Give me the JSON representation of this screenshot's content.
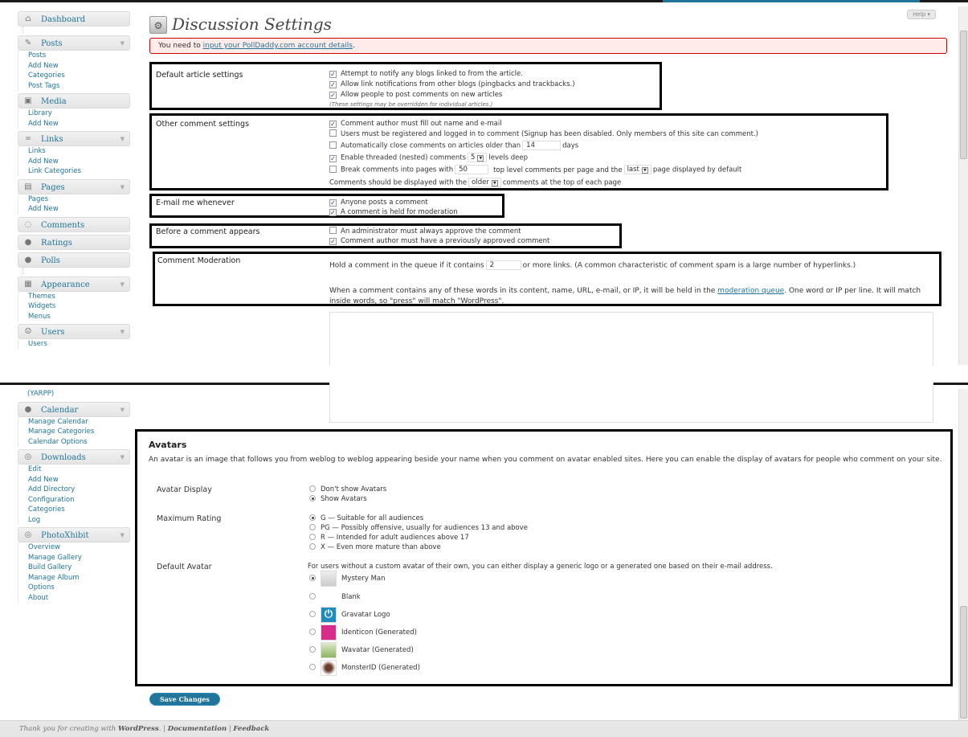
{
  "page": {
    "title": "Discussion Settings",
    "help": "Help ▾"
  },
  "notice": {
    "prefix": "You need to ",
    "link": "input your PollDaddy.com account details",
    "suffix": "."
  },
  "sidebar_top": {
    "dashboard": "Dashboard",
    "posts": "Posts",
    "posts_items": [
      "Posts",
      "Add New",
      "Categories",
      "Post Tags"
    ],
    "media": "Media",
    "media_items": [
      "Library",
      "Add New"
    ],
    "links": "Links",
    "links_items": [
      "Links",
      "Add New",
      "Link Categories"
    ],
    "pages": "Pages",
    "pages_items": [
      "Pages",
      "Add New"
    ],
    "comments": "Comments",
    "ratings": "Ratings",
    "polls": "Polls",
    "appearance": "Appearance",
    "appearance_items": [
      "Themes",
      "Widgets",
      "Menus"
    ],
    "users": "Users",
    "users_items": [
      "Users"
    ]
  },
  "sidebar_bottom": {
    "partial": "(YARPP)",
    "calendar": "Calendar",
    "calendar_items": [
      "Manage Calendar",
      "Manage Categories",
      "Calendar Options"
    ],
    "downloads": "Downloads",
    "downloads_items": [
      "Edit",
      "Add New",
      "Add Directory",
      "Configuration",
      "Categories",
      "Log"
    ],
    "photoxhibit": "PhotoXhibit",
    "photoxhibit_items": [
      "Overview",
      "Manage Gallery",
      "Build Gallery",
      "Manage Album",
      "Options",
      "About"
    ]
  },
  "default_article": {
    "label": "Default article settings",
    "opt1": "Attempt to notify any blogs linked to from the article.",
    "opt2": "Allow link notifications from other blogs (pingbacks and trackbacks.)",
    "opt3": "Allow people to post comments on new articles",
    "note": "(These settings may be overridden for individual articles.)"
  },
  "other_comment": {
    "label": "Other comment settings",
    "opt1": "Comment author must fill out name and e-mail",
    "opt2": "Users must be registered and logged in to comment (Signup has been disabled. Only members of this site can comment.)",
    "opt3_pre": "Automatically close comments on articles older than",
    "opt3_val": "14",
    "opt3_post": "days",
    "opt4_pre": "Enable threaded (nested) comments",
    "opt4_val": "5",
    "opt4_post": "levels deep",
    "opt5_pre": "Break comments into pages with",
    "opt5_val": "50",
    "opt5_mid": "top level comments per page and the",
    "opt5_sel": "last",
    "opt5_post": "page displayed by default",
    "opt6_pre": "Comments should be displayed with the",
    "opt6_sel": "older",
    "opt6_post": "comments at the top of each page"
  },
  "email_me": {
    "label": "E-mail me whenever",
    "opt1": "Anyone posts a comment",
    "opt2": "A comment is held for moderation"
  },
  "before_appears": {
    "label": "Before a comment appears",
    "opt1": "An administrator must always approve the comment",
    "opt2": "Comment author must have a previously approved comment"
  },
  "moderation": {
    "label": "Comment Moderation",
    "hold_pre": "Hold a comment in the queue if it contains",
    "hold_val": "2",
    "hold_post": "or more links. (A common characteristic of comment spam is a large number of hyperlinks.)",
    "words_pre": "When a comment contains any of these words in its content, name, URL, e-mail, or IP, it will be held in the ",
    "words_link": "moderation queue",
    "words_post": ". One word or IP per line. It will match inside words, so \"press\" will match \"WordPress\"."
  },
  "avatars": {
    "title": "Avatars",
    "desc": "An avatar is an image that follows you from weblog to weblog appearing beside your name when you comment on avatar enabled sites. Here you can enable the display of avatars for people who comment on your site.",
    "display_label": "Avatar Display",
    "display_opt1": "Don't show Avatars",
    "display_opt2": "Show Avatars",
    "rating_label": "Maximum Rating",
    "rating_g": "G — Suitable for all audiences",
    "rating_pg": "PG — Possibly offensive, usually for audiences 13 and above",
    "rating_r": "R — Intended for adult audiences above 17",
    "rating_x": "X — Even more mature than above",
    "default_label": "Default Avatar",
    "default_desc": "For users without a custom avatar of their own, you can either display a generic logo or a generated one based on their e-mail address.",
    "av_mystery": "Mystery Man",
    "av_blank": "Blank",
    "av_gravatar": "Gravatar Logo",
    "av_identicon": "Identicon (Generated)",
    "av_wavatar": "Wavatar (Generated)",
    "av_monster": "MonsterID (Generated)"
  },
  "save_label": "Save Changes",
  "footer": {
    "prefix": "Thank you for creating with ",
    "wp": "WordPress",
    "sep1": ". | ",
    "docs": "Documentation",
    "sep2": " | ",
    "feedback": "Feedback"
  },
  "colors": {
    "link": "#21759b",
    "notice_bg": "#ffebe8",
    "notice_border": "#cc0000",
    "highlight_border": "#000000"
  }
}
